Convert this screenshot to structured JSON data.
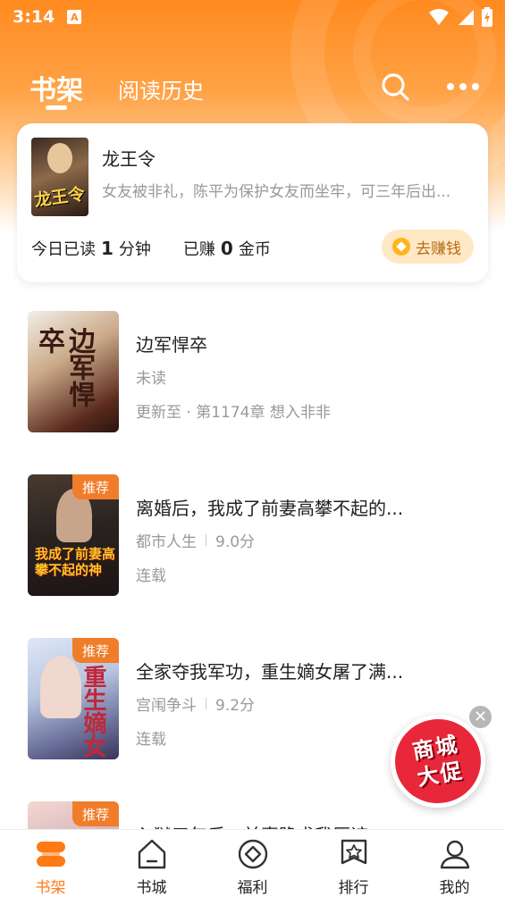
{
  "status_bar": {
    "time": "3:14",
    "notification_letter": "A"
  },
  "header": {
    "tabs": [
      {
        "label": "书架",
        "active": true
      },
      {
        "label": "阅读历史",
        "active": false
      }
    ],
    "icons": [
      "search-icon",
      "more-icon"
    ]
  },
  "current_reading": {
    "title": "龙王令",
    "cover_text": "龙王令",
    "description": "女友被非礼，陈平为保护女友而坐牢，可三年后出...",
    "read_today_prefix": "今日已读",
    "read_today_value": "1",
    "read_today_unit": "分钟",
    "earned_prefix": "已赚",
    "earned_value": "0",
    "earned_unit": "金币",
    "earn_button": "去赚钱"
  },
  "books": [
    {
      "title": "边军悍卒",
      "cover_text": "边军悍卒",
      "line2": "未读",
      "line3": "更新至 · 第1174章  想入非非",
      "badge": ""
    },
    {
      "title": "离婚后，我成了前妻高攀不起的...",
      "cover_text": "我成了前妻高攀不起的神",
      "genre": "都市人生",
      "score": "9.0分",
      "status": "连载",
      "badge": "推荐"
    },
    {
      "title": "全家夺我军功，重生嫡女屠了满...",
      "cover_text": "重生嫡女",
      "genre": "宫闱争斗",
      "score": "9.2分",
      "status": "连载",
      "badge": "推荐"
    },
    {
      "title": "入狱三年后，前妻跪求我原谅",
      "badge": "推荐"
    }
  ],
  "promo": {
    "line1": "商城",
    "line2": "大促"
  },
  "bottom_nav": [
    {
      "label": "书架",
      "icon": "bookshelf-icon",
      "active": true
    },
    {
      "label": "书城",
      "icon": "bookstore-icon",
      "active": false
    },
    {
      "label": "福利",
      "icon": "welfare-icon",
      "active": false
    },
    {
      "label": "排行",
      "icon": "ranking-icon",
      "active": false
    },
    {
      "label": "我的",
      "icon": "profile-icon",
      "active": false
    }
  ],
  "colors": {
    "accent": "#ff7a14",
    "header_orange": "#ff8a1f",
    "badge_orange": "#f07d2a",
    "promo_red": "#e8283a"
  }
}
